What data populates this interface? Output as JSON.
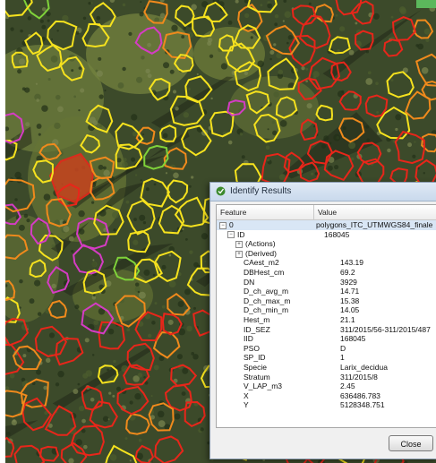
{
  "dialog": {
    "title": "Identify Results",
    "columns": {
      "feature": "Feature",
      "value": "Value"
    },
    "close_label": "Close",
    "rows": [
      {
        "key": "0",
        "value": "polygons_ITC_UTMWGS84_finale",
        "level": 0,
        "expander": "minus"
      },
      {
        "key": "ID",
        "value": "168045",
        "level": 1,
        "expander": "minus"
      },
      {
        "key": "(Actions)",
        "value": "",
        "level": 2,
        "expander": "plus"
      },
      {
        "key": "(Derived)",
        "value": "",
        "level": 2,
        "expander": "plus"
      },
      {
        "key": "CAest_m2",
        "value": "143.19",
        "level": 3
      },
      {
        "key": "DBHest_cm",
        "value": "69.2",
        "level": 3
      },
      {
        "key": "DN",
        "value": "3929",
        "level": 3
      },
      {
        "key": "D_ch_avg_m",
        "value": "14.71",
        "level": 3
      },
      {
        "key": "D_ch_max_m",
        "value": "15.38",
        "level": 3
      },
      {
        "key": "D_ch_min_m",
        "value": "14.05",
        "level": 3
      },
      {
        "key": "Hest_m",
        "value": "21.1",
        "level": 3
      },
      {
        "key": "ID_SEZ",
        "value": "311/2015/56-311/2015/487",
        "level": 3
      },
      {
        "key": "IID",
        "value": "168045",
        "level": 3
      },
      {
        "key": "PSO",
        "value": "D",
        "level": 3
      },
      {
        "key": "SP_ID",
        "value": "1",
        "level": 3
      },
      {
        "key": "Specie",
        "value": "Larix_decidua",
        "level": 3
      },
      {
        "key": "Stratum",
        "value": "311/2015/8",
        "level": 3
      },
      {
        "key": "V_LAP_m3",
        "value": "2.45",
        "level": 3
      },
      {
        "key": "X",
        "value": "636486.783",
        "level": 3
      },
      {
        "key": "Y",
        "value": "5128348.751",
        "level": 3
      }
    ]
  },
  "map": {
    "icons": {
      "dialog": "qgis-identify-icon"
    },
    "colors": {
      "yellow": "#f6e21e",
      "orange": "#f08a1c",
      "red": "#e8261a",
      "magenta": "#d53cc4",
      "green": "#7fd23a",
      "selected_fill": "#c0451f"
    }
  }
}
